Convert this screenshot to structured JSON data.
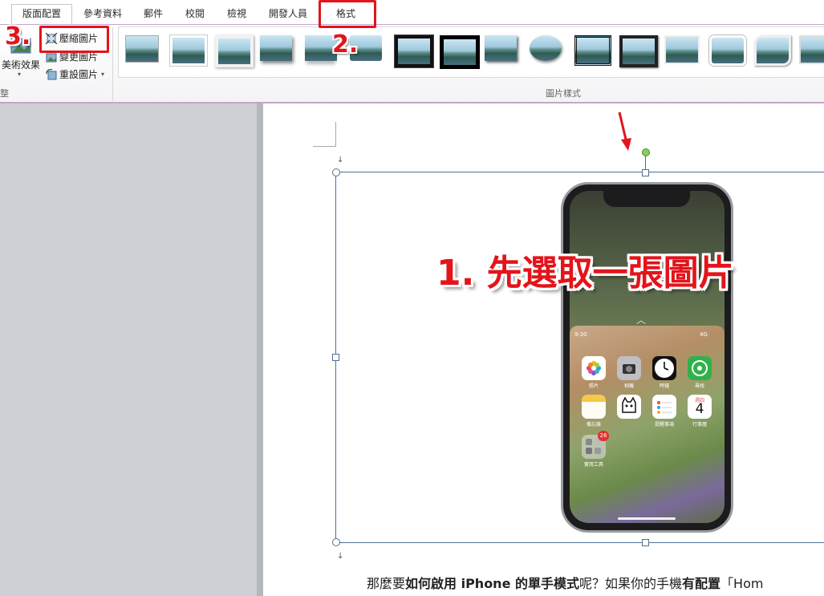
{
  "tabs": [
    {
      "label": "版面配置",
      "active": true
    },
    {
      "label": "參考資料"
    },
    {
      "label": "郵件"
    },
    {
      "label": "校閱"
    },
    {
      "label": "檢視"
    },
    {
      "label": "開發人員"
    },
    {
      "label": "格式"
    }
  ],
  "ribbon": {
    "artistic_effects_label": "美術效果",
    "compress_label": "壓縮圖片",
    "change_label": "變更圖片",
    "reset_label": "重設圖片",
    "left_group_label": "整",
    "styles_group_label": "圖片樣式"
  },
  "annotations": {
    "step1": "1. 先選取一張圖片",
    "step2": "2.",
    "step3": "3.",
    "accent_color": "#e3141b"
  },
  "phone_screen": {
    "status_time": "9:30",
    "status_right": "4G",
    "calendar_weekday": "週四",
    "calendar_day": "4",
    "badge_count": "26",
    "app_labels": [
      "照片",
      "相機",
      "時鐘",
      "尋找",
      "備忘錄",
      "",
      "提醒事項",
      "行事曆",
      "實用工具"
    ]
  },
  "document": {
    "body_prefix": "那麼要",
    "body_bold1": "如何啟用 iPhone 的單手模式",
    "body_mid": "呢？如果你的手機",
    "body_bold2": "有配置",
    "body_end": "「Hom"
  }
}
